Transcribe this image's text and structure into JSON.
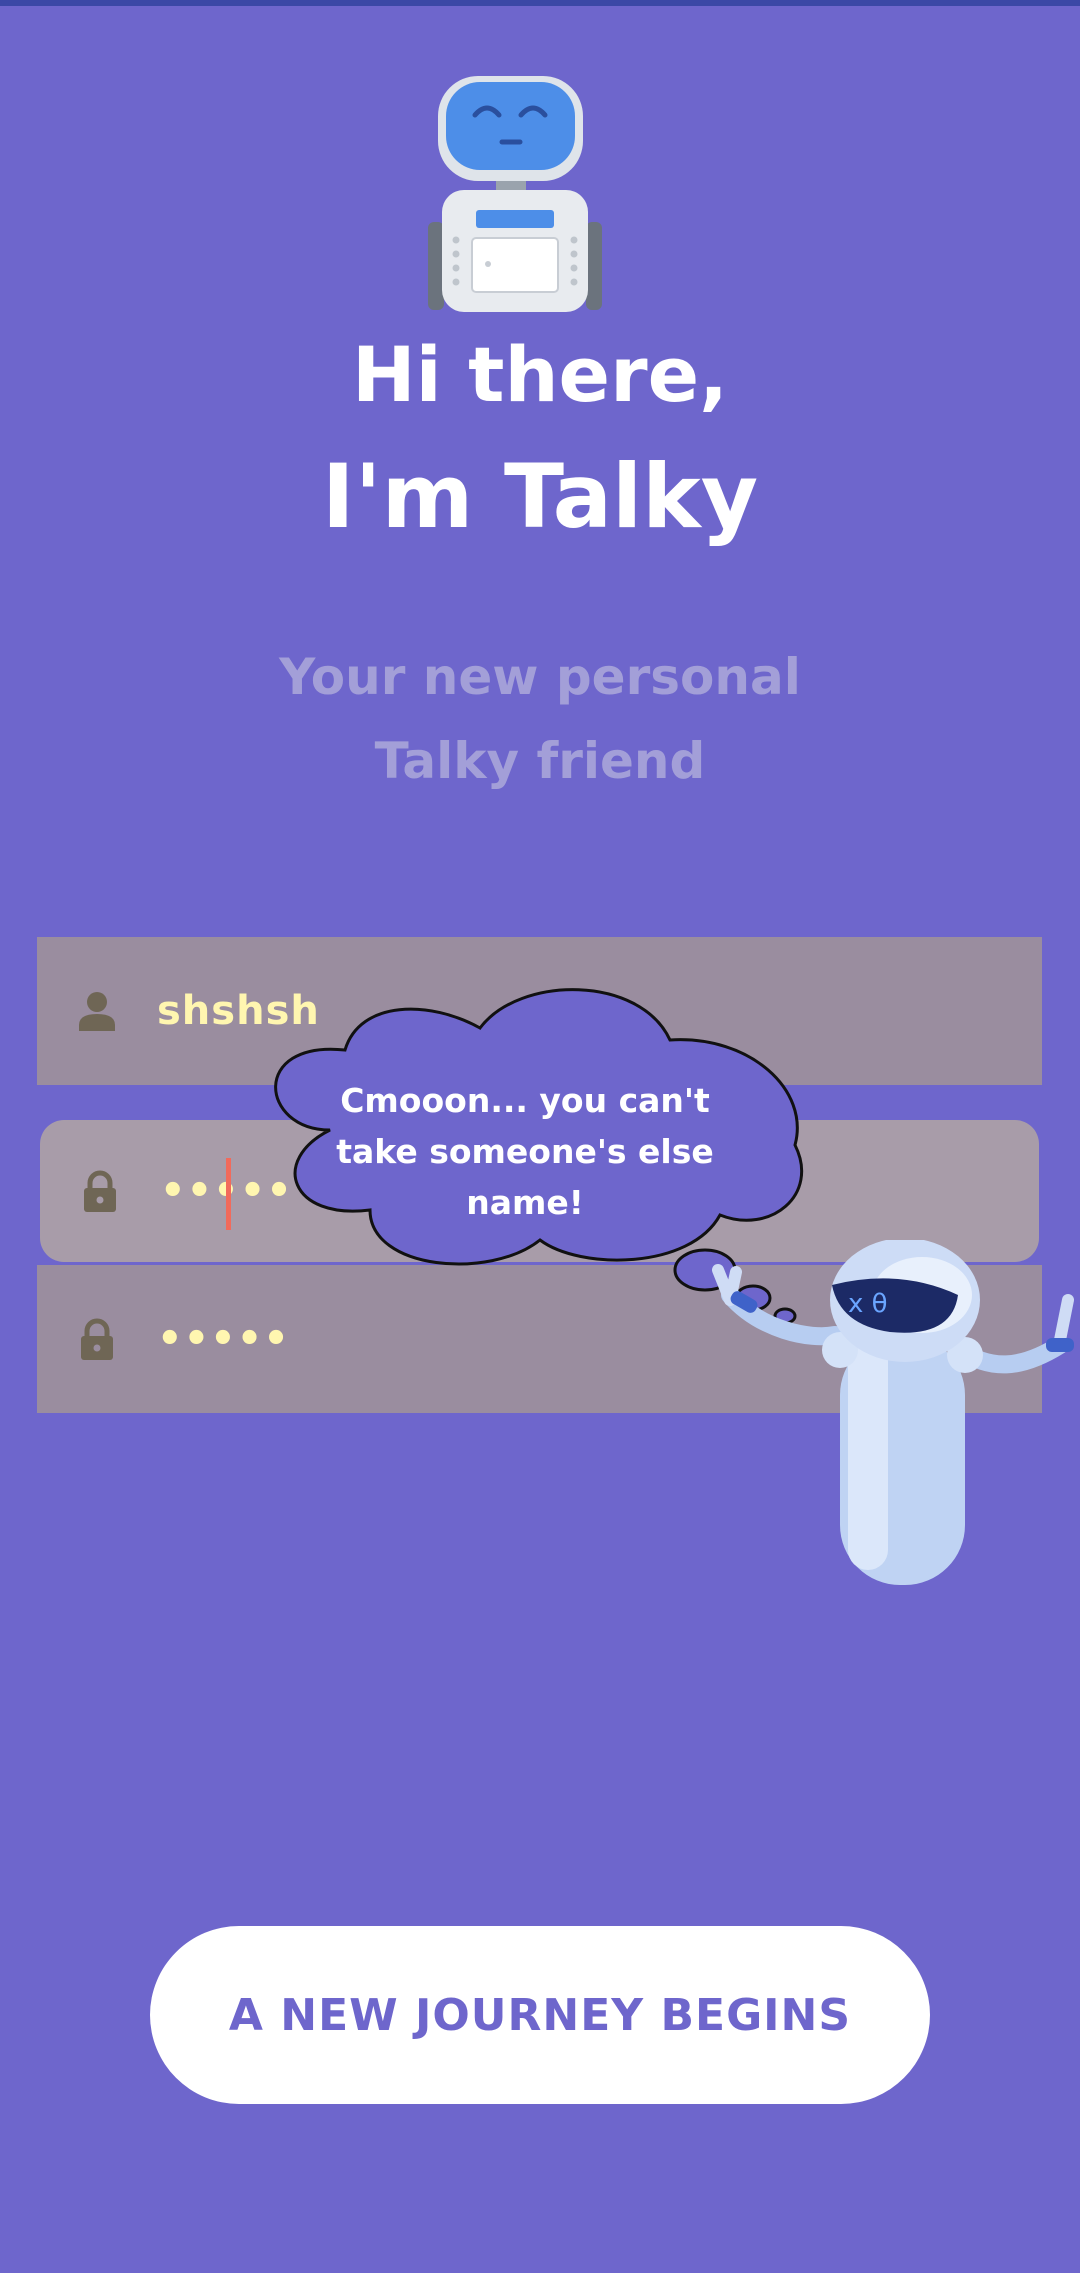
{
  "status_bar_color": "#3b48a6",
  "background_color": "#6e66cc",
  "logo": {
    "icon": "robot-icon"
  },
  "heading": {
    "line1": "Hi there,",
    "line2": "I'm Talky"
  },
  "subheading": {
    "line1": "Your new personal",
    "line2": "Talky friend"
  },
  "form": {
    "username": {
      "icon": "person-icon",
      "value": "shshsh"
    },
    "password": {
      "icon": "lock-icon",
      "value": "•••••"
    },
    "confirm_password": {
      "icon": "lock-icon",
      "value": "•••••"
    }
  },
  "speech_bubble": {
    "lines": [
      "Cmooon... you can't",
      "take someone's else",
      "name!"
    ]
  },
  "mascot": {
    "icon": "waving-robot-icon"
  },
  "cta": {
    "label": "A NEW JOURNEY BEGINS",
    "text_color": "#6e66cc"
  }
}
